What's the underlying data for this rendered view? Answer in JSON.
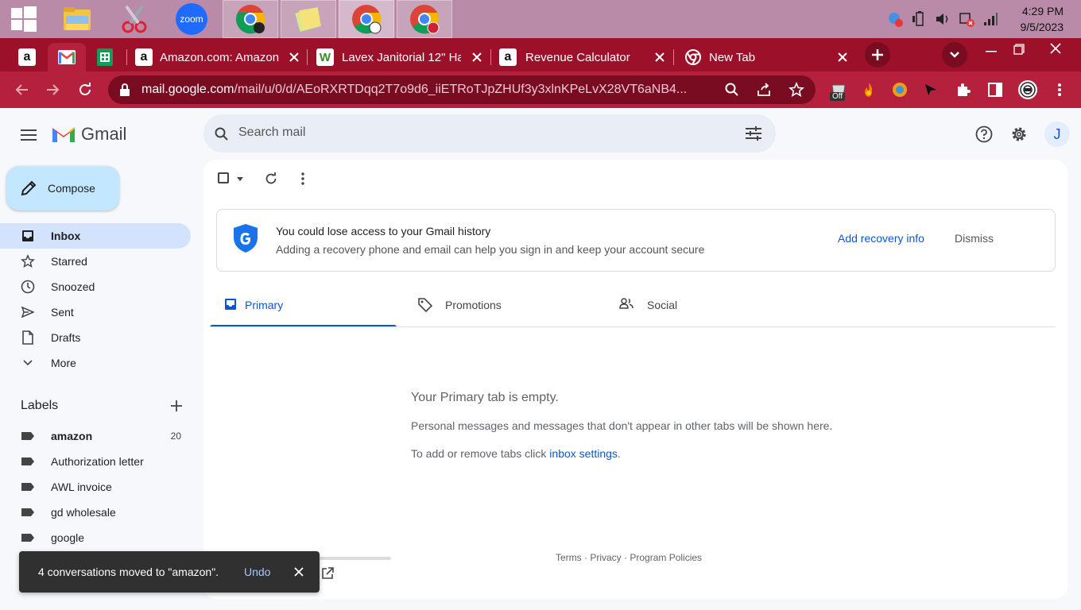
{
  "taskbar": {
    "apps": [
      {
        "name": "windows-start"
      },
      {
        "name": "file-explorer"
      },
      {
        "name": "snipping-tool"
      },
      {
        "name": "zoom",
        "label": "zoom"
      },
      {
        "name": "chrome-1"
      },
      {
        "name": "sticky-notes"
      },
      {
        "name": "chrome-2"
      },
      {
        "name": "chrome-3"
      }
    ],
    "clock": {
      "time": "4:29 PM",
      "date": "9/5/2023"
    }
  },
  "browser": {
    "tabs": [
      {
        "title": "Amazon.com: Amazon",
        "icon": "amazon-icon"
      },
      {
        "title": "Lavex Janitorial 12\" Ha",
        "icon": "lavex-icon"
      },
      {
        "title": "Revenue Calculator",
        "icon": "amazon-icon"
      },
      {
        "title": "New Tab",
        "icon": "chrome-icon"
      }
    ],
    "url_domain": "mail.google.com",
    "url_path": "/mail/u/0/d/AEoRXRTDqq2T7o9d6_iiETRoTJpZHUf3y3xlnKPeLvX28VT6aNB4...",
    "extension_badge": "Off"
  },
  "gmail": {
    "brand": "Gmail",
    "search_placeholder": "Search mail",
    "avatar": "J",
    "compose_label": "Compose",
    "nav": [
      {
        "label": "Inbox",
        "icon": "inbox-icon",
        "active": true
      },
      {
        "label": "Starred",
        "icon": "star-icon"
      },
      {
        "label": "Snoozed",
        "icon": "clock-icon"
      },
      {
        "label": "Sent",
        "icon": "send-icon"
      },
      {
        "label": "Drafts",
        "icon": "draft-icon"
      },
      {
        "label": "More",
        "icon": "chevron-down-icon"
      }
    ],
    "labels_heading": "Labels",
    "labels": [
      {
        "label": "amazon",
        "count": "20",
        "bold": true
      },
      {
        "label": "Authorization letter"
      },
      {
        "label": "AWL invoice"
      },
      {
        "label": "gd wholesale"
      },
      {
        "label": "google"
      }
    ],
    "banner": {
      "title": "You could lose access to your Gmail history",
      "text": "Adding a recovery phone and email can help you sign in and keep your account secure",
      "action": "Add recovery info",
      "dismiss": "Dismiss"
    },
    "tabs": [
      {
        "label": "Primary",
        "icon": "inbox-icon",
        "active": true
      },
      {
        "label": "Promotions",
        "icon": "tag-icon"
      },
      {
        "label": "Social",
        "icon": "people-icon"
      }
    ],
    "empty": {
      "title": "Your Primary tab is empty.",
      "line1": "Personal messages and messages that don't appear in other tabs will be shown here.",
      "line2_prefix": "To add or remove tabs click ",
      "line2_link": "inbox settings",
      "line2_suffix": "."
    },
    "footer": {
      "terms": "Terms",
      "privacy": "Privacy",
      "policies": "Program Policies",
      "sep": " · "
    },
    "snackbar": {
      "message": "4 conversations moved to \"amazon\".",
      "action": "Undo"
    }
  }
}
